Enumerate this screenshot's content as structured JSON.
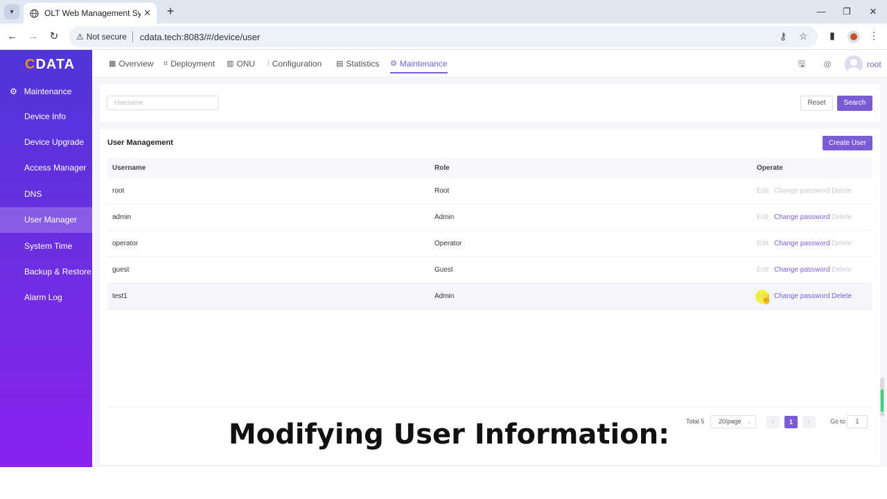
{
  "browser": {
    "tab_title": "OLT Web Management Syste",
    "security_label": "Not secure",
    "url": "cdata.tech:8083/#/device/user"
  },
  "app": {
    "logo_text": "DATA",
    "logo_letter": "C",
    "brand_color": "#7b5cd6"
  },
  "sidebar": {
    "section": "Maintenance",
    "items": [
      {
        "label": "Device Info"
      },
      {
        "label": "Device Upgrade"
      },
      {
        "label": "Access Manager"
      },
      {
        "label": "DNS"
      },
      {
        "label": "User Manager",
        "active": true
      },
      {
        "label": "System Time"
      },
      {
        "label": "Backup & Restore"
      },
      {
        "label": "Alarm Log"
      }
    ]
  },
  "topnav": {
    "items": [
      {
        "label": "Overview",
        "icon": "grid-icon"
      },
      {
        "label": "Deployment",
        "icon": "deploy-icon"
      },
      {
        "label": "ONU",
        "icon": "onu-icon"
      },
      {
        "label": "Configuration",
        "icon": "sliders-icon"
      },
      {
        "label": "Statistics",
        "icon": "chart-icon"
      },
      {
        "label": "Maintenance",
        "icon": "gear-icon",
        "active": true
      }
    ],
    "user": "root"
  },
  "filter": {
    "username_placeholder": "Username",
    "reset_label": "Reset",
    "search_label": "Search"
  },
  "table": {
    "title": "User Management",
    "create_label": "Create User",
    "columns": [
      "Username",
      "Role",
      "Operate"
    ],
    "actions": {
      "edit": "Edit",
      "change_password": "Change password",
      "delete": "Delete"
    },
    "rows": [
      {
        "username": "root",
        "role": "Root"
      },
      {
        "username": "admin",
        "role": "Admin"
      },
      {
        "username": "operator",
        "role": "Operator"
      },
      {
        "username": "guest",
        "role": "Guest"
      },
      {
        "username": "test1",
        "role": "Admin"
      }
    ]
  },
  "pagination": {
    "total": "Total 5",
    "page_size": "20/page",
    "current_page": "1",
    "goto_label": "Go to",
    "goto_value": "1"
  },
  "caption": "Modifying User Information:"
}
